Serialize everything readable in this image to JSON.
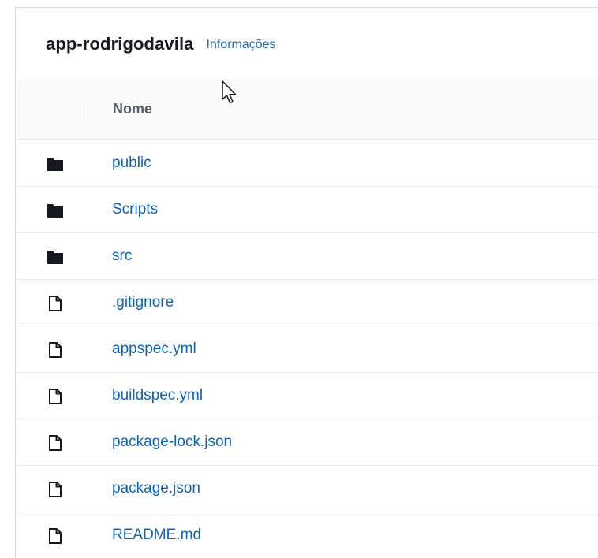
{
  "header": {
    "title": "app-rodrigodavila",
    "info_link": "Informações"
  },
  "table": {
    "column_name": "Nome",
    "rows": [
      {
        "name": "public",
        "type": "folder"
      },
      {
        "name": "Scripts",
        "type": "folder"
      },
      {
        "name": "src",
        "type": "folder"
      },
      {
        "name": ".gitignore",
        "type": "file"
      },
      {
        "name": "appspec.yml",
        "type": "file"
      },
      {
        "name": "buildspec.yml",
        "type": "file"
      },
      {
        "name": "package-lock.json",
        "type": "file"
      },
      {
        "name": "package.json",
        "type": "file"
      },
      {
        "name": "README.md",
        "type": "file"
      }
    ]
  },
  "icons": {
    "folder": "folder-icon",
    "file": "file-icon"
  },
  "colors": {
    "link": "#0f63b5",
    "title": "#16191f",
    "column_header_bg": "#fafafa"
  }
}
